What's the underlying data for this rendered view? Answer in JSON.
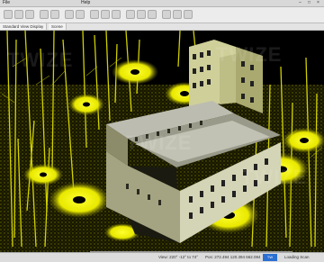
{
  "menu": {
    "first": "File",
    "help": "Help"
  },
  "window_buttons": [
    "–",
    "□",
    "×"
  ],
  "tabs": [
    "Standard View Display",
    "Scene"
  ],
  "watermark": "TWIZE",
  "status": {
    "view": "View: 220° -12° to 74°",
    "position": "Pos: 272.494 120.394 662.084",
    "loading": "Loading Scan",
    "logo": "TW"
  },
  "dock": {
    "icons": [
      "select-icon",
      "orbit-icon",
      "pan-icon",
      "zoom-icon",
      "measure-icon",
      "clip-icon",
      "camera-icon",
      "fly-icon",
      "walk-icon",
      "home-icon",
      "settings-icon"
    ],
    "glyphs": [
      "◌",
      "↻",
      "✥",
      "⊕",
      "▭",
      "✂",
      "◉",
      "✈",
      "⊿",
      "⌂",
      "⚙"
    ]
  },
  "colors": {
    "points": "#f2f20a",
    "background": "#000000",
    "chrome": "#ececec"
  }
}
